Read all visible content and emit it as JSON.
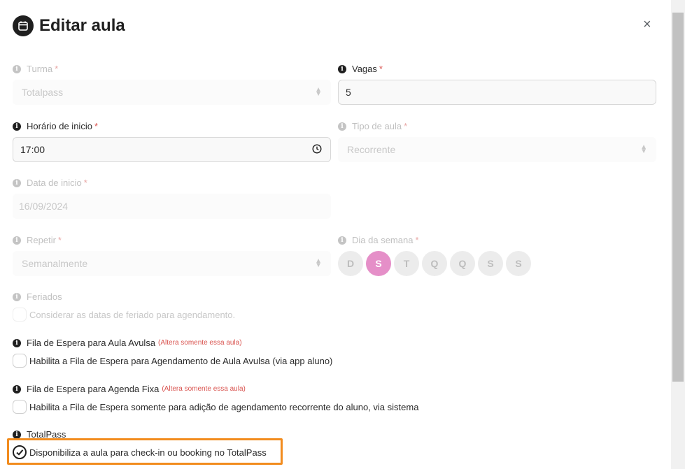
{
  "modal": {
    "title": "Editar aula",
    "close_label": "×"
  },
  "fields": {
    "turma": {
      "label": "Turma",
      "value": "Totalpass"
    },
    "vagas": {
      "label": "Vagas",
      "value": "5"
    },
    "horario": {
      "label": "Horário de inicio",
      "value": "17:00"
    },
    "tipo": {
      "label": "Tipo de aula",
      "value": "Recorrente"
    },
    "data": {
      "label": "Data de inicio",
      "value": "16/09/2024"
    },
    "repetir": {
      "label": "Repetir",
      "value": "Semanalmente"
    },
    "dia_semana": {
      "label": "Dia da semana",
      "days": [
        "D",
        "S",
        "T",
        "Q",
        "Q",
        "S",
        "S"
      ],
      "selected_index": 1
    },
    "feriados": {
      "label": "Feriados",
      "option": "Considerar as datas de feriado para agendamento."
    },
    "fila_avulsa": {
      "label": "Fila de Espera para Aula Avulsa",
      "note": "(Altera somente essa aula)",
      "option": "Habilita a Fila de Espera para Agendamento de Aula Avulsa (via app aluno)"
    },
    "fila_fixa": {
      "label": "Fila de Espera para Agenda Fixa",
      "note": "(Altera somente essa aula)",
      "option": "Habilita a Fila de Espera somente para adição de agendamento recorrente do aluno, via sistema"
    },
    "totalpass": {
      "label": "TotalPass",
      "option": "Disponibiliza a aula para check-in ou booking no TotalPass",
      "checked": true
    }
  },
  "required_mark": "*",
  "info_glyph": "i",
  "colors": {
    "accent_pink": "#e58fc8",
    "highlight_orange": "#f28c1e",
    "required_red": "#d9534f"
  }
}
